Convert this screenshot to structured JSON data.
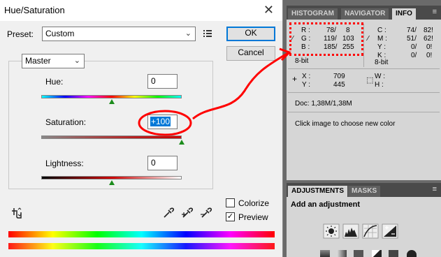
{
  "dialog": {
    "title": "Hue/Saturation",
    "close_glyph": "✕",
    "preset_label": "Preset:",
    "preset_value": "Custom",
    "ok_label": "OK",
    "cancel_label": "Cancel",
    "channel_value": "Master",
    "hue": {
      "label": "Hue:",
      "value": "0",
      "level": 0.5
    },
    "saturation": {
      "label": "Saturation:",
      "value": "+100",
      "level": 1.0
    },
    "lightness": {
      "label": "Lightness:",
      "value": "0",
      "level": 0.5
    },
    "colorize_label": "Colorize",
    "colorize_checked": false,
    "preview_label": "Preview",
    "preview_checked": true
  },
  "info_panel": {
    "tabs": [
      "HISTOGRAM",
      "NAVIGATOR",
      "INFO"
    ],
    "active_tab": "INFO",
    "rgb": {
      "R": [
        "78/",
        "8"
      ],
      "G": [
        "119/",
        "103"
      ],
      "B": [
        "185/",
        "255"
      ]
    },
    "cmyk": {
      "C": [
        "74/",
        "82!"
      ],
      "M": [
        "51/",
        "62!"
      ],
      "Y": [
        "0/",
        "0!"
      ],
      "K": [
        "0/",
        "0!"
      ]
    },
    "bit_left": "8-bit",
    "bit_right": "8-bit",
    "x_label": "X :",
    "x_value": "709",
    "y_label": "Y :",
    "y_value": "445",
    "w_label": "W :",
    "h_label": "H :",
    "doc": "Doc: 1,38M/1,38M",
    "hint": "Click image to choose new color"
  },
  "adjustments_panel": {
    "tabs": [
      "ADJUSTMENTS",
      "MASKS"
    ],
    "active_tab": "ADJUSTMENTS",
    "heading": "Add an adjustment"
  },
  "colors": {
    "highlight": "#ff0000",
    "accent": "#0078d7",
    "slider_thumb": "#1c8c1c"
  }
}
